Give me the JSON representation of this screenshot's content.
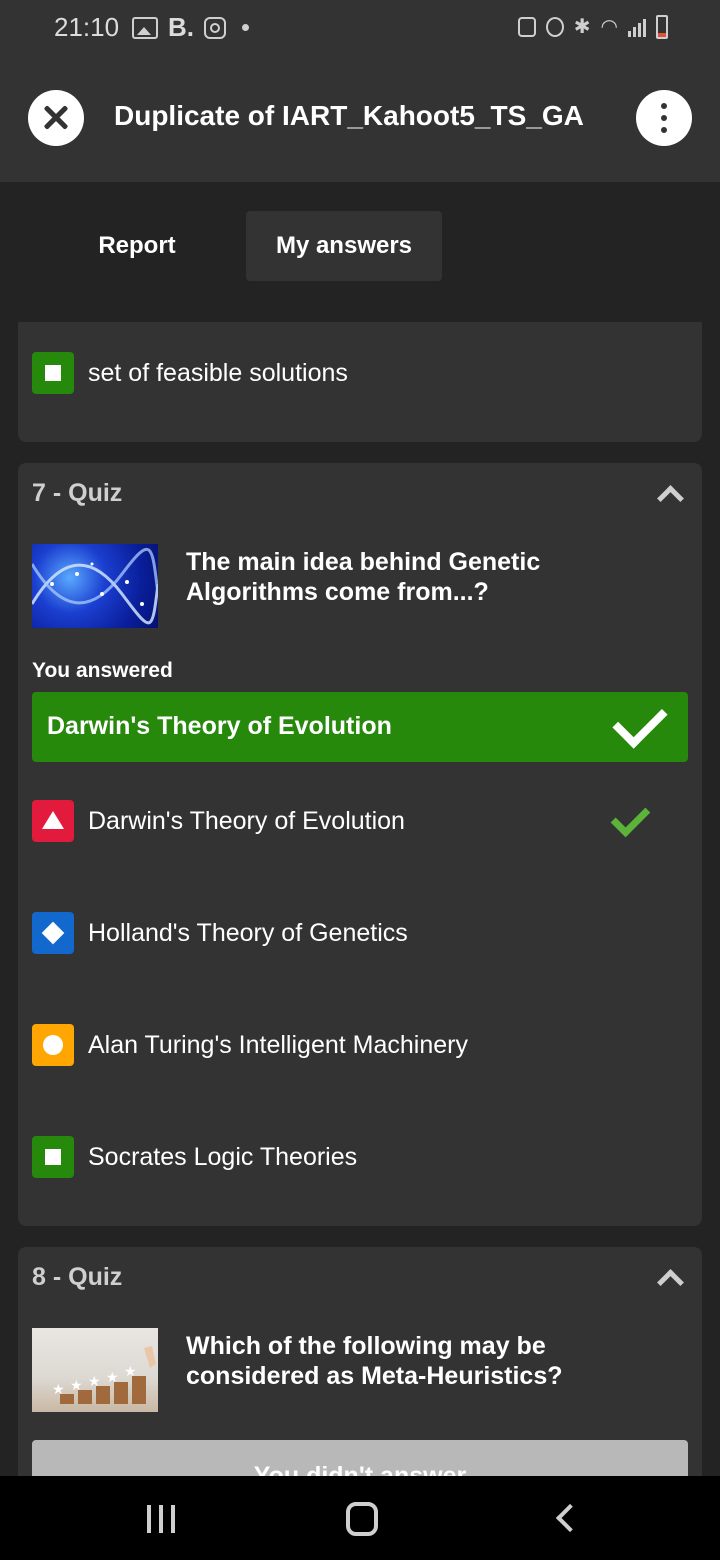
{
  "status_bar": {
    "time": "21:10",
    "left_icons": [
      "gallery-icon",
      "b-app-icon",
      "instagram-icon",
      "dot-icon"
    ],
    "b_label": "B.",
    "right_icons": [
      "lock-icon",
      "alarm-icon",
      "bluetooth-icon",
      "wifi-icon",
      "signal-icon",
      "battery-icon"
    ]
  },
  "header": {
    "title": "Duplicate of IART_Kahoot5_TS_GA"
  },
  "tabs": [
    {
      "label": "Report",
      "active": false
    },
    {
      "label": "My answers",
      "active": true
    }
  ],
  "previous_card": {
    "answer": {
      "shape": "square",
      "color": "#26890c",
      "text": "set of feasible solutions"
    }
  },
  "questions": [
    {
      "label": "7 - Quiz",
      "image": "dna-helix-image",
      "question": "The main idea behind Genetic Algorithms come from...?",
      "you_answered_label": "You answered",
      "answered": "Darwin's Theory of Evolution",
      "answers": [
        {
          "shape": "triangle",
          "color": "#e21b3c",
          "text": "Darwin's Theory of Evolution",
          "correct": true
        },
        {
          "shape": "diamond",
          "color": "#1368ce",
          "text": "Holland's Theory of Genetics",
          "correct": false
        },
        {
          "shape": "circle",
          "color": "#ffa602",
          "text": "Alan Turing's Intelligent Machinery",
          "correct": false
        },
        {
          "shape": "square",
          "color": "#26890c",
          "text": "Socrates Logic Theories",
          "correct": false
        }
      ]
    },
    {
      "label": "8 - Quiz",
      "image": "rating-stars-image",
      "question": "Which of the following may be considered as Meta-Heuristics?",
      "not_answered": "You didn't answer"
    }
  ],
  "colors": {
    "background": "#232323",
    "card": "#333333",
    "correct_green": "#26890c",
    "check_green": "#5bb33a"
  }
}
